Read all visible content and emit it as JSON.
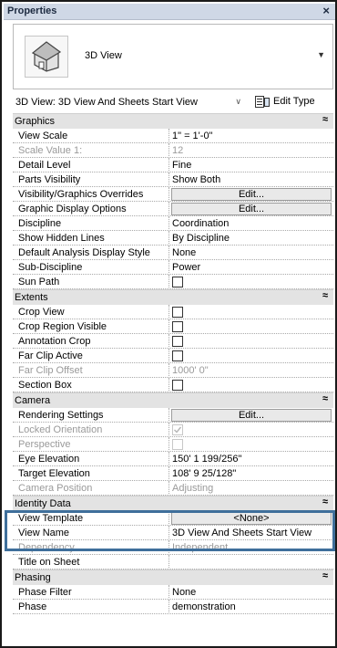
{
  "panel": {
    "title": "Properties",
    "close_glyph": "×"
  },
  "type_selector": {
    "name": "3D View",
    "icon": "house-3d-icon",
    "arrow": "▼"
  },
  "instance_selector": {
    "value": "3D View: 3D View And Sheets Start View",
    "arrow": "∨",
    "edit_type_label": "Edit Type"
  },
  "collapse_glyph": "≈",
  "categories": {
    "graphics": "Graphics",
    "extents": "Extents",
    "camera": "Camera",
    "identity": "Identity Data",
    "phasing": "Phasing"
  },
  "graphics": {
    "view_scale": [
      "View Scale",
      "1\" = 1'-0\""
    ],
    "scale_value": [
      "Scale Value   1:",
      "12"
    ],
    "detail_level": [
      "Detail Level",
      "Fine"
    ],
    "parts_visibility": [
      "Parts Visibility",
      "Show Both"
    ],
    "vg_overrides": [
      "Visibility/Graphics Overrides",
      "Edit..."
    ],
    "graphic_display": [
      "Graphic Display Options",
      "Edit..."
    ],
    "discipline": [
      "Discipline",
      "Coordination"
    ],
    "hidden_lines": [
      "Show Hidden Lines",
      "By Discipline"
    ],
    "analysis_style": [
      "Default Analysis Display Style",
      "None"
    ],
    "sub_discipline": [
      "Sub-Discipline",
      "Power"
    ],
    "sun_path": [
      "Sun Path",
      ""
    ]
  },
  "extents": {
    "crop_view": [
      "Crop View",
      ""
    ],
    "crop_region_visible": [
      "Crop Region Visible",
      ""
    ],
    "annotation_crop": [
      "Annotation Crop",
      ""
    ],
    "far_clip_active": [
      "Far Clip Active",
      ""
    ],
    "far_clip_offset": [
      "Far Clip Offset",
      "1000'  0\""
    ],
    "section_box": [
      "Section Box",
      ""
    ]
  },
  "camera": {
    "rendering_settings": [
      "Rendering Settings",
      "Edit..."
    ],
    "locked_orientation": [
      "Locked Orientation",
      ""
    ],
    "perspective": [
      "Perspective",
      ""
    ],
    "eye_elevation": [
      "Eye Elevation",
      "150'  1 199/256\""
    ],
    "target_elevation": [
      "Target Elevation",
      "108'  9 25/128\""
    ],
    "camera_position": [
      "Camera Position",
      "Adjusting"
    ]
  },
  "identity": {
    "view_template": [
      "View Template",
      "<None>"
    ],
    "view_name": [
      "View Name",
      "3D View And Sheets Start View"
    ],
    "dependency": [
      "Dependency",
      "Independent"
    ],
    "title_on_sheet": [
      "Title on Sheet",
      ""
    ]
  },
  "phasing": {
    "phase_filter": [
      "Phase Filter",
      "None"
    ],
    "phase": [
      "Phase",
      "demonstration"
    ]
  },
  "colors": {
    "highlight": "#3f6f9b",
    "titlebar": "#cfd8e6",
    "category": "#e3e3e3"
  }
}
